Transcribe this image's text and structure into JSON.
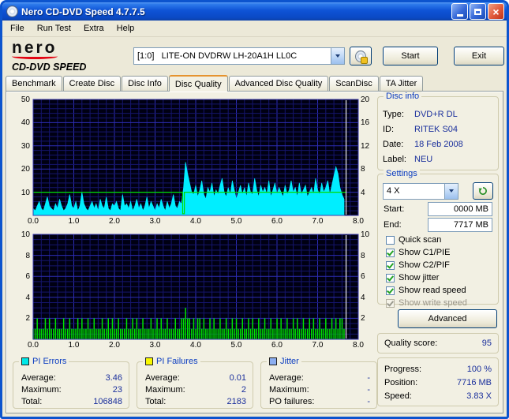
{
  "window": {
    "title": "Nero CD-DVD Speed 4.7.7.5"
  },
  "menu": {
    "items": [
      "File",
      "Run Test",
      "Extra",
      "Help"
    ]
  },
  "logo": {
    "brand": "nero",
    "product": "CD-DVD SPEED"
  },
  "toolbar": {
    "drive_selector": "[1:0]   LITE-ON DVDRW LH-20A1H LL0C",
    "start_button": "Start",
    "exit_button": "Exit"
  },
  "tabs": {
    "items": [
      "Benchmark",
      "Create Disc",
      "Disc Info",
      "Disc Quality",
      "Advanced Disc Quality",
      "ScanDisc",
      "TA Jitter"
    ],
    "active": "Disc Quality"
  },
  "disc_info": {
    "title": "Disc info",
    "rows": [
      {
        "label": "Type:",
        "value": "DVD+R DL"
      },
      {
        "label": "ID:",
        "value": "RITEK S04"
      },
      {
        "label": "Date:",
        "value": "18 Feb 2008"
      },
      {
        "label": "Label:",
        "value": "NEU"
      }
    ]
  },
  "settings": {
    "title": "Settings",
    "speed": "4 X",
    "start_label": "Start:",
    "start_value": "0000 MB",
    "end_label": "End:",
    "end_value": "7717 MB",
    "checkboxes": [
      {
        "label": "Quick scan",
        "checked": false,
        "disabled": false
      },
      {
        "label": "Show C1/PIE",
        "checked": true,
        "disabled": false
      },
      {
        "label": "Show C2/PIF",
        "checked": true,
        "disabled": false
      },
      {
        "label": "Show jitter",
        "checked": true,
        "disabled": false
      },
      {
        "label": "Show read speed",
        "checked": true,
        "disabled": false
      },
      {
        "label": "Show write speed",
        "checked": true,
        "disabled": true
      }
    ],
    "advanced_button": "Advanced"
  },
  "quality": {
    "label": "Quality score:",
    "value": "95"
  },
  "status": {
    "rows": [
      {
        "label": "Progress:",
        "value": "100 %"
      },
      {
        "label": "Position:",
        "value": "7716 MB"
      },
      {
        "label": "Speed:",
        "value": "3.83 X"
      }
    ]
  },
  "legends": [
    {
      "title": "PI Errors",
      "color": "#00E8E8",
      "rows": [
        {
          "label": "Average:",
          "value": "3.46"
        },
        {
          "label": "Maximum:",
          "value": "23"
        },
        {
          "label": "Total:",
          "value": "106848"
        }
      ]
    },
    {
      "title": "PI Failures",
      "color": "#F8F800",
      "rows": [
        {
          "label": "Average:",
          "value": "0.01"
        },
        {
          "label": "Maximum:",
          "value": "2"
        },
        {
          "label": "Total:",
          "value": "2183"
        }
      ]
    },
    {
      "title": "Jitter",
      "color": "#8CAEF0",
      "rows": [
        {
          "label": "Average:",
          "value": "-"
        },
        {
          "label": "Maximum:",
          "value": "-"
        },
        {
          "label": "PO failures:",
          "value": "-"
        }
      ]
    }
  ],
  "chart_data": [
    {
      "type": "area",
      "title": "PI Errors (PIE) and read speed vs disc position (GB)",
      "xlim": [
        0,
        8
      ],
      "x_tick_step": 1,
      "x_tick_labels": [
        "0.0",
        "1.0",
        "2.0",
        "3.0",
        "4.0",
        "5.0",
        "6.0",
        "7.0",
        "8.0"
      ],
      "ylim_left": [
        0,
        50
      ],
      "ylim_right": [
        0,
        20
      ],
      "left_ticks": [
        10,
        20,
        30,
        40,
        50
      ],
      "right_ticks": [
        4,
        8,
        12,
        16,
        20
      ],
      "grid": {
        "x_minor": 0.2,
        "x_major": 1,
        "y_minor": 2,
        "y_major": 10
      },
      "cursor_x": 7.7,
      "series": [
        {
          "name": "PIE",
          "style": "area",
          "color": "#00EEFF",
          "axis": "left",
          "x_start": 0,
          "x_step": 0.05,
          "values": [
            3,
            2,
            4,
            6,
            3,
            2,
            5,
            8,
            4,
            3,
            2,
            5,
            3,
            7,
            4,
            2,
            3,
            5,
            9,
            4,
            3,
            6,
            2,
            4,
            10,
            5,
            3,
            2,
            4,
            6,
            3,
            5,
            2,
            7,
            4,
            3,
            8,
            3,
            2,
            5,
            4,
            6,
            3,
            2,
            9,
            4,
            5,
            3,
            6,
            2,
            4,
            7,
            3,
            5,
            2,
            4,
            8,
            3,
            6,
            4,
            2,
            5,
            3,
            7,
            4,
            2,
            6,
            3,
            5,
            9,
            4,
            3,
            6,
            5,
            12,
            23,
            18,
            14,
            10,
            9,
            13,
            8,
            11,
            15,
            9,
            7,
            12,
            10,
            14,
            8,
            11,
            9,
            13,
            16,
            10,
            8,
            12,
            9,
            15,
            11,
            7,
            10,
            13,
            9,
            12,
            8,
            14,
            10,
            9,
            16,
            11,
            8,
            13,
            10,
            12,
            9,
            15,
            8,
            11,
            14,
            9,
            12,
            10,
            8,
            13,
            9,
            11,
            15,
            10,
            12,
            8,
            14,
            9,
            11,
            13,
            8,
            10,
            12,
            9,
            16,
            11,
            9,
            14,
            10,
            12,
            15,
            9,
            13,
            17,
            21,
            18,
            12,
            9,
            7
          ]
        },
        {
          "name": "read-speed",
          "style": "line",
          "color": "#00DD00",
          "axis": "right",
          "points": [
            [
              0,
              4
            ],
            [
              3.68,
              4
            ],
            [
              3.68,
              0.3
            ],
            [
              3.72,
              0.3
            ],
            [
              3.72,
              4
            ],
            [
              7.7,
              4
            ]
          ]
        }
      ]
    },
    {
      "type": "bar",
      "title": "PI Failures (PIF) vs disc position (GB)",
      "xlim": [
        0,
        8
      ],
      "x_tick_step": 1,
      "x_tick_labels": [
        "0.0",
        "1.0",
        "2.0",
        "3.0",
        "4.0",
        "5.0",
        "6.0",
        "7.0",
        "8.0"
      ],
      "ylim_left": [
        0,
        10
      ],
      "ylim_right": [
        0,
        10
      ],
      "left_ticks": [
        2,
        4,
        6,
        8,
        10
      ],
      "right_ticks": [
        2,
        4,
        6,
        8,
        10
      ],
      "grid": {
        "x_minor": 0.2,
        "x_major": 1,
        "y_minor": 0.5,
        "y_major": 2
      },
      "cursor_x": 7.7,
      "series": [
        {
          "name": "PIF",
          "style": "bars",
          "color": "#00E400",
          "axis": "left",
          "x_start": 0,
          "x_step": 0.05,
          "values": [
            1,
            1,
            2,
            1,
            1,
            1,
            2,
            1,
            2,
            1,
            1,
            2,
            1,
            1,
            1,
            2,
            1,
            1,
            2,
            1,
            1,
            1,
            2,
            1,
            2,
            1,
            1,
            2,
            1,
            1,
            2,
            1,
            1,
            1,
            2,
            1,
            1,
            2,
            1,
            2,
            1,
            1,
            2,
            1,
            1,
            1,
            2,
            1,
            1,
            2,
            1,
            2,
            1,
            1,
            2,
            1,
            1,
            1,
            2,
            1,
            1,
            2,
            1,
            2,
            1,
            1,
            2,
            1,
            1,
            1,
            2,
            1,
            1,
            2,
            2,
            3,
            2,
            2,
            1,
            2,
            1,
            2,
            2,
            1,
            2,
            1,
            1,
            2,
            1,
            2,
            1,
            1,
            2,
            1,
            1,
            2,
            1,
            1,
            2,
            1,
            2,
            1,
            1,
            2,
            1,
            1,
            2,
            1,
            2,
            1,
            1,
            2,
            1,
            1,
            2,
            1,
            1,
            2,
            1,
            1,
            2,
            1,
            2,
            1,
            1,
            2,
            1,
            1,
            2,
            1,
            2,
            1,
            1,
            2,
            1,
            1,
            2,
            1,
            2,
            1,
            1,
            2,
            1,
            1,
            2,
            1,
            1,
            2,
            1,
            2,
            1,
            2,
            2,
            1
          ]
        }
      ]
    }
  ]
}
